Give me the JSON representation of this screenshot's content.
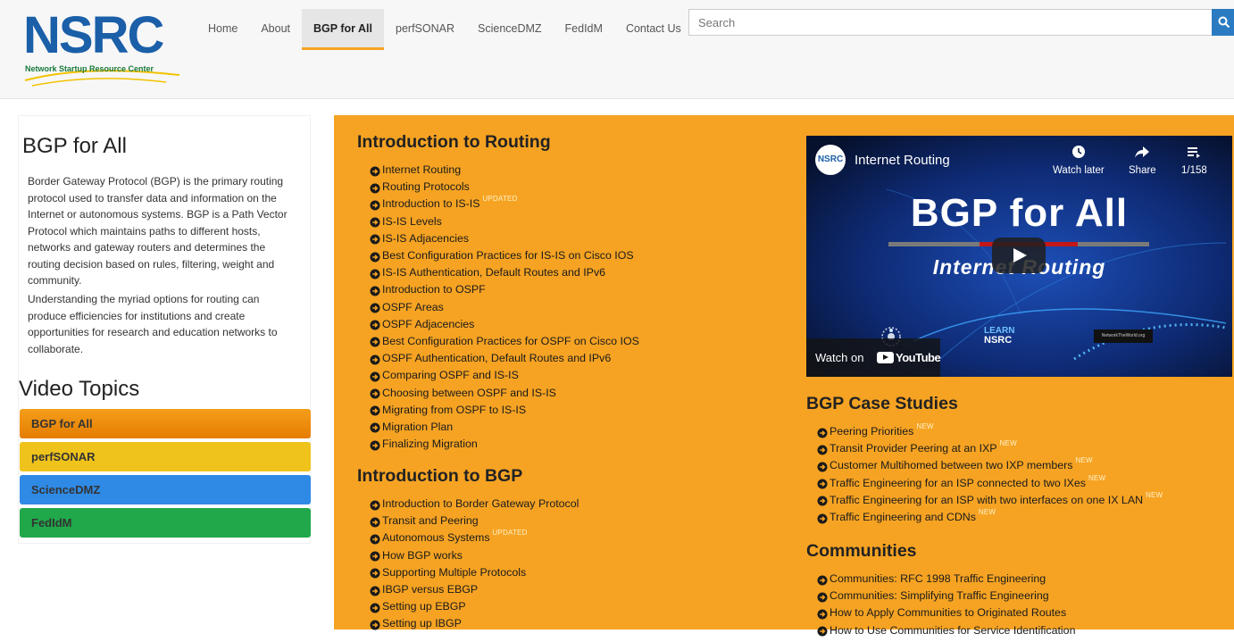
{
  "logo": {
    "text": "NSRC",
    "subtitle": "Network Startup Resource Center"
  },
  "nav": {
    "items": [
      {
        "label": "Home"
      },
      {
        "label": "About"
      },
      {
        "label": "BGP for All",
        "active": true
      },
      {
        "label": "perfSONAR"
      },
      {
        "label": "ScienceDMZ"
      },
      {
        "label": "FedIdM"
      },
      {
        "label": "Contact Us"
      }
    ]
  },
  "search": {
    "placeholder": "Search",
    "value": "",
    "icon": "search-icon"
  },
  "sidebar": {
    "title": "BGP for All",
    "p1": "Border Gateway Protocol (BGP) is the primary routing protocol used to transfer data and information on the Internet or autonomous systems. BGP is a Path Vector Protocol which maintains paths to different hosts, networks and gateway routers and determines the routing decision based on rules, filtering, weight and community.",
    "p2": "Understanding the myriad options for routing can produce efficiencies for institutions and create opportunities for research and education networks to collaborate.",
    "video_topics_title": "Video Topics",
    "topics": [
      {
        "label": "BGP for All",
        "color": "#e98a0c"
      },
      {
        "label": "perfSONAR",
        "color": "#efc31c"
      },
      {
        "label": "ScienceDMZ",
        "color": "#2f8ae6"
      },
      {
        "label": "FedIdM",
        "color": "#20a84a"
      }
    ]
  },
  "colors": {
    "panel": "#f6a323",
    "nav_active_underline": "#f6a323",
    "search_button": "#2a7bc2"
  },
  "sections": {
    "routing": {
      "title": "Introduction to Routing",
      "items": [
        {
          "label": "Internet Routing"
        },
        {
          "label": "Routing Protocols"
        },
        {
          "label": "Introduction to IS-IS",
          "tag": "UPDATED"
        },
        {
          "label": "IS-IS Levels"
        },
        {
          "label": "IS-IS Adjacencies"
        },
        {
          "label": "Best Configuration Practices for IS-IS on Cisco IOS"
        },
        {
          "label": "IS-IS Authentication, Default Routes and IPv6"
        },
        {
          "label": "Introduction to OSPF"
        },
        {
          "label": "OSPF Areas"
        },
        {
          "label": "OSPF Adjacencies"
        },
        {
          "label": "Best Configuration Practices for OSPF on Cisco IOS"
        },
        {
          "label": "OSPF Authentication, Default Routes and IPv6"
        },
        {
          "label": "Comparing OSPF and IS-IS"
        },
        {
          "label": "Choosing between OSPF and IS-IS"
        },
        {
          "label": "Migrating from OSPF to IS-IS"
        },
        {
          "label": "Migration Plan"
        },
        {
          "label": "Finalizing Migration"
        }
      ]
    },
    "bgp": {
      "title": "Introduction to BGP",
      "items": [
        {
          "label": "Introduction to Border Gateway Protocol"
        },
        {
          "label": "Transit and Peering"
        },
        {
          "label": "Autonomous Systems",
          "tag": "UPDATED"
        },
        {
          "label": "How BGP works"
        },
        {
          "label": "Supporting Multiple Protocols"
        },
        {
          "label": "IBGP versus EBGP"
        },
        {
          "label": "Setting up EBGP"
        },
        {
          "label": "Setting up IBGP"
        }
      ]
    },
    "case_studies": {
      "title": "BGP Case Studies",
      "items": [
        {
          "label": "Peering Priorities",
          "tag": "NEW"
        },
        {
          "label": "Transit Provider Peering at an IXP",
          "tag": "NEW"
        },
        {
          "label": "Customer Multihomed between two IXP members",
          "tag": "NEW"
        },
        {
          "label": "Traffic Engineering for an ISP connected to two IXes",
          "tag": "NEW"
        },
        {
          "label": "Traffic Engineering for an ISP with two interfaces on one IX LAN",
          "tag": "NEW"
        },
        {
          "label": "Traffic Engineering and CDNs",
          "tag": "NEW"
        }
      ]
    },
    "communities": {
      "title": "Communities",
      "items": [
        {
          "label": "Communities: RFC 1998 Traffic Engineering"
        },
        {
          "label": "Communities: Simplifying Traffic Engineering"
        },
        {
          "label": "How to Apply Communities to Originated Routes"
        },
        {
          "label": "How to Use Communities for Service Identification"
        }
      ]
    }
  },
  "video": {
    "channel_logo": "NSRC",
    "title": "Internet Routing",
    "watch_later": "Watch later",
    "share": "Share",
    "playlist_count": "1/158",
    "headline": "BGP for All",
    "subheadline": "Internet Routing",
    "watch_on": "Watch on",
    "youtube": "YouTube",
    "learn_logo_top": "LEARN",
    "learn_logo_bottom": "NSRC",
    "ntw_logo": "NetworkTheWorld.org"
  }
}
